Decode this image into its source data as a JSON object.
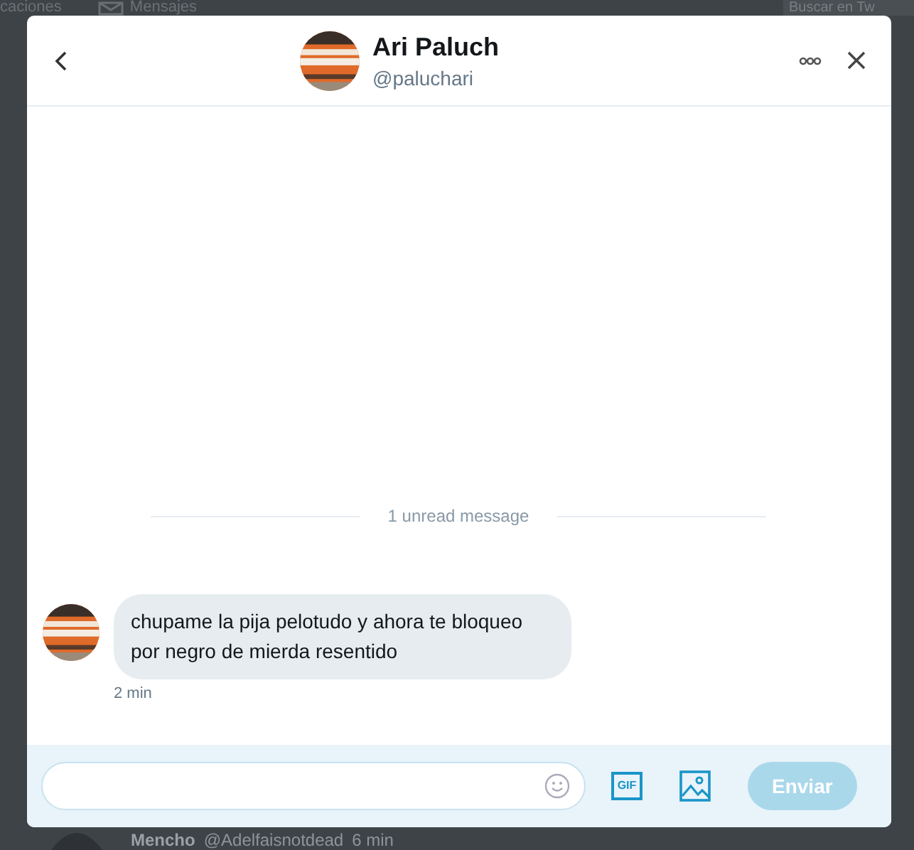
{
  "background": {
    "top_items": [
      {
        "label": "caciones",
        "kind": "text"
      },
      {
        "label": "Mensajes",
        "kind": "mail"
      }
    ],
    "search": {
      "placeholder": "Buscar en Tw"
    },
    "bottom_tweet": {
      "name": "Mencho",
      "handle": "@Adelfaisnotdead",
      "time": "6 min"
    }
  },
  "dialog": {
    "name": "Ari Paluch",
    "handle": "@paluchari"
  },
  "divider": "1 unread message",
  "messages": [
    {
      "text": "chupame la pija pelotudo y ahora te bloqueo por negro de mierda resentido",
      "time": "2 min"
    }
  ],
  "composer": {
    "gif": "GIF",
    "send": "Enviar",
    "send_disabled": true
  }
}
